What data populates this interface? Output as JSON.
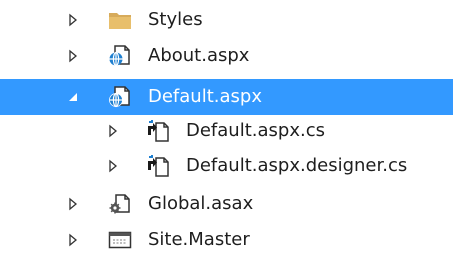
{
  "tree": {
    "items": [
      {
        "label": "Styles",
        "icon": "folder-icon",
        "expander": "collapsed"
      },
      {
        "label": "About.aspx",
        "icon": "web-form-icon",
        "expander": "collapsed"
      },
      {
        "label": "Default.aspx",
        "icon": "web-form-icon",
        "expander": "expanded",
        "selected": true
      },
      {
        "label": "Default.aspx.cs",
        "icon": "csharp-file-icon",
        "expander": "collapsed"
      },
      {
        "label": "Default.aspx.designer.cs",
        "icon": "csharp-file-icon",
        "expander": "collapsed"
      },
      {
        "label": "Global.asax",
        "icon": "global-asax-icon",
        "expander": "collapsed"
      },
      {
        "label": "Site.Master",
        "icon": "master-page-icon",
        "expander": "collapsed"
      }
    ]
  },
  "colors": {
    "selection": "#3399ff",
    "text": "#1e1e1e",
    "selected_text": "#ffffff",
    "folder": "#d7ab5b",
    "globe": "#1e7fd0"
  }
}
